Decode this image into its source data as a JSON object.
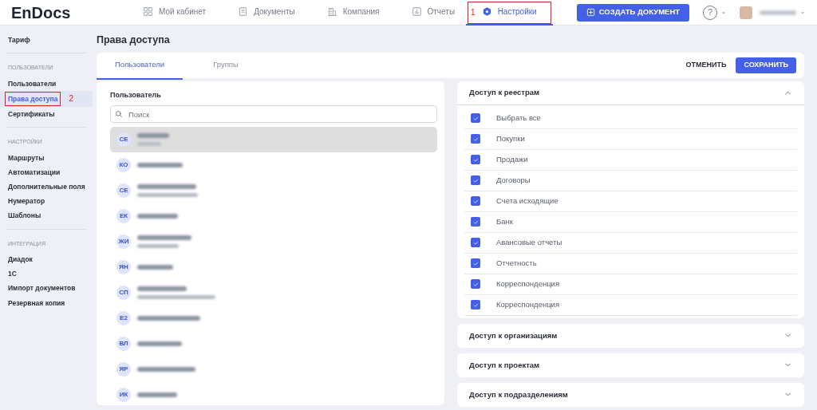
{
  "logo": "EnDocs",
  "nav": [
    {
      "label": "Мой кабинет",
      "selected": false
    },
    {
      "label": "Документы",
      "selected": false
    },
    {
      "label": "Компания",
      "selected": false
    },
    {
      "label": "Отчеты",
      "selected": false
    },
    {
      "label": "Настройки",
      "selected": true,
      "marker": "1"
    }
  ],
  "create_button": "СОЗДАТЬ ДОКУМЕНТ",
  "help": "?",
  "sidebar": [
    {
      "kind": "item",
      "label": "Тариф",
      "selected": false
    },
    {
      "kind": "divider"
    },
    {
      "kind": "heading",
      "label": "ПОЛЬЗОВАТЕЛИ"
    },
    {
      "kind": "item",
      "label": "Пользователи",
      "selected": false
    },
    {
      "kind": "item",
      "label": "Права доступа",
      "selected": true,
      "marker": "2"
    },
    {
      "kind": "item",
      "label": "Сертификаты",
      "selected": false
    },
    {
      "kind": "divider"
    },
    {
      "kind": "heading",
      "label": "НАСТРОЙКИ"
    },
    {
      "kind": "item",
      "label": "Маршруты",
      "selected": false
    },
    {
      "kind": "item",
      "label": "Автоматизации",
      "selected": false
    },
    {
      "kind": "item",
      "label": "Дополнительные поля",
      "selected": false
    },
    {
      "kind": "item",
      "label": "Нумератор",
      "selected": false
    },
    {
      "kind": "item",
      "label": "Шаблоны",
      "selected": false
    },
    {
      "kind": "divider"
    },
    {
      "kind": "heading",
      "label": "ИНТЕГРАЦИЯ"
    },
    {
      "kind": "item",
      "label": "Диадок",
      "selected": false
    },
    {
      "kind": "item",
      "label": "1С",
      "selected": false
    },
    {
      "kind": "item",
      "label": "Импорт документов",
      "selected": false
    },
    {
      "kind": "item",
      "label": "Резервная копия",
      "selected": false
    }
  ],
  "page_title": "Права доступа",
  "tabs": [
    {
      "label": "Пользователи",
      "selected": true
    },
    {
      "label": "Группы",
      "selected": false
    }
  ],
  "actions": {
    "cancel": "ОТМЕНИТЬ",
    "save": "СОХРАНИТЬ"
  },
  "users_panel": {
    "label": "Пользователь",
    "search": {
      "placeholder": "Поиск"
    },
    "users": [
      {
        "initials": "СЕ",
        "kind": "two-line",
        "selected": true
      },
      {
        "initials": "КО",
        "kind": "one-line",
        "selected": false
      },
      {
        "initials": "СЕ",
        "kind": "two-line",
        "selected": false
      },
      {
        "initials": "ЕК",
        "kind": "one-line",
        "selected": false
      },
      {
        "initials": "ЖИ",
        "kind": "two-line",
        "selected": false
      },
      {
        "initials": "ЯН",
        "kind": "one-line",
        "selected": false
      },
      {
        "initials": "СП",
        "kind": "two-line",
        "selected": false
      },
      {
        "initials": "Е2",
        "kind": "one-line",
        "selected": false
      },
      {
        "initials": "ВЛ",
        "kind": "one-line",
        "selected": false
      },
      {
        "initials": "ЯР",
        "kind": "one-line",
        "selected": false
      },
      {
        "initials": "ИК",
        "kind": "one-line",
        "selected": false
      }
    ]
  },
  "access_sections": [
    {
      "title": "Доступ к реестрам",
      "expanded": true,
      "items": [
        {
          "label": "Выбрать все",
          "checked": true
        },
        {
          "label": "Покупки",
          "checked": true
        },
        {
          "label": "Продажи",
          "checked": true
        },
        {
          "label": "Договоры",
          "checked": true
        },
        {
          "label": "Счета исходящие",
          "checked": true
        },
        {
          "label": "Банк",
          "checked": true
        },
        {
          "label": "Авансовые отчеты",
          "checked": true
        },
        {
          "label": "Отчетность",
          "checked": true
        },
        {
          "label": "Корреспонденция",
          "checked": true
        },
        {
          "label": "Корреспонденция",
          "checked": true
        }
      ]
    },
    {
      "title": "Доступ к организациям",
      "expanded": false
    },
    {
      "title": "Доступ к проектам",
      "expanded": false
    },
    {
      "title": "Доступ к подразделениям",
      "expanded": false
    }
  ]
}
